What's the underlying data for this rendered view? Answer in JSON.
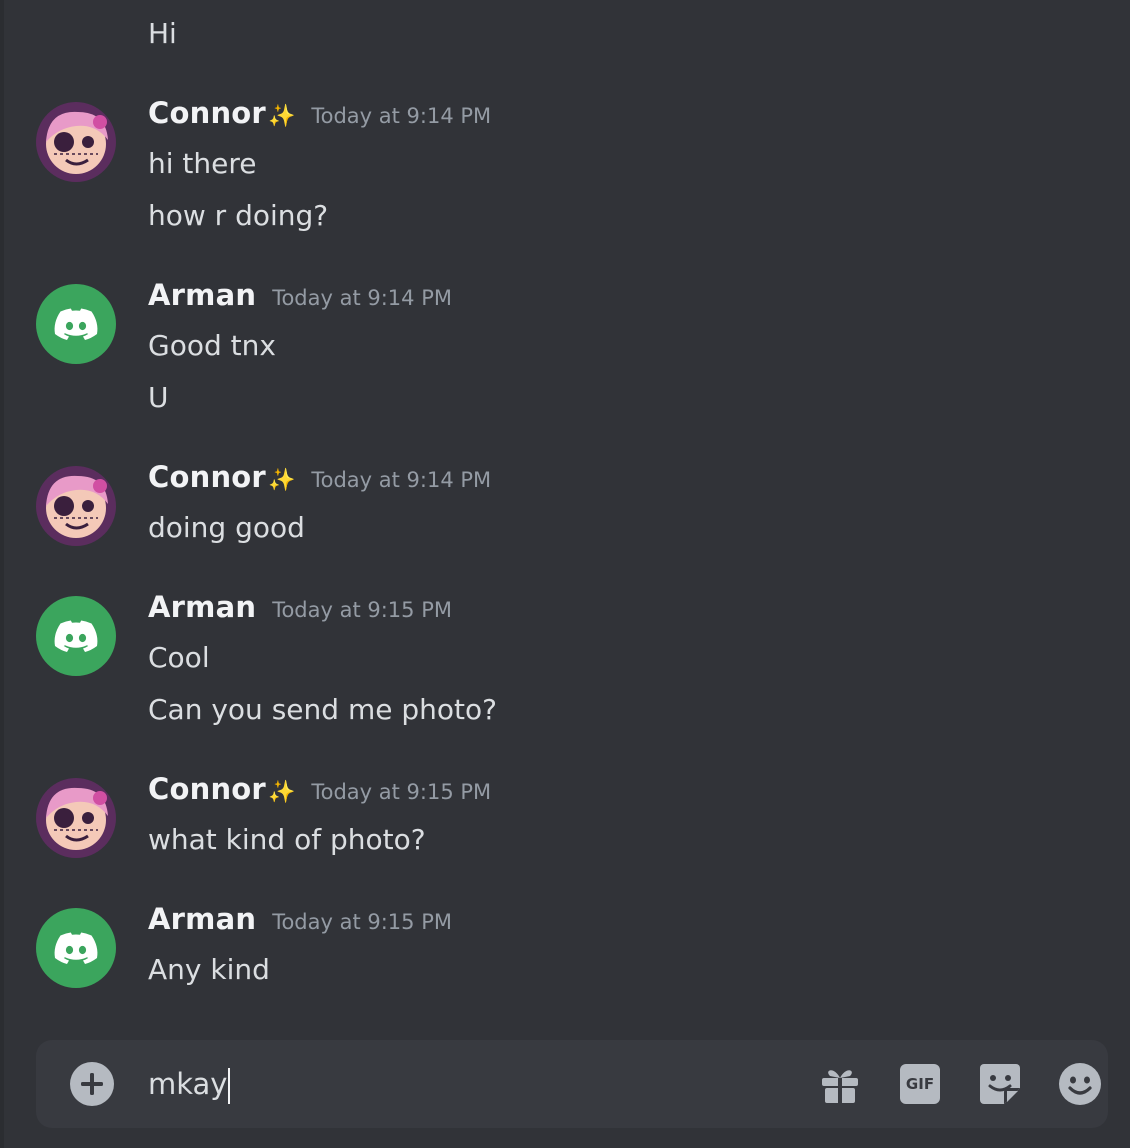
{
  "previous_message": "Hi",
  "messages": [
    {
      "author": "Connor",
      "badge": "✨",
      "timestamp": "Today at 9:14 PM",
      "avatar": "connor-avatar",
      "lines": [
        "hi there",
        "how r doing?"
      ]
    },
    {
      "author": "Arman",
      "timestamp": "Today at 9:14 PM",
      "avatar": "discord-default-avatar",
      "lines": [
        "Good tnx",
        "U"
      ]
    },
    {
      "author": "Connor",
      "badge": "✨",
      "timestamp": "Today at 9:14 PM",
      "avatar": "connor-avatar",
      "lines": [
        "doing good"
      ]
    },
    {
      "author": "Arman",
      "timestamp": "Today at 9:15 PM",
      "avatar": "discord-default-avatar",
      "lines": [
        "Cool",
        "Can you send me photo?"
      ]
    },
    {
      "author": "Connor",
      "badge": "✨",
      "timestamp": "Today at 9:15 PM",
      "avatar": "connor-avatar",
      "lines": [
        "what kind of photo?"
      ]
    },
    {
      "author": "Arman",
      "timestamp": "Today at 9:15 PM",
      "avatar": "discord-default-avatar",
      "lines": [
        "Any kind"
      ]
    }
  ],
  "composer": {
    "value": "mkay",
    "icons": [
      "plus-circle-icon",
      "gift-icon",
      "gif-icon",
      "sticker-icon",
      "emoji-icon"
    ],
    "gif_label": "GIF"
  },
  "colors": {
    "background": "#313338",
    "composer": "#383a40",
    "discord_green": "#3ba55d",
    "timestamp": "#949ba4"
  }
}
